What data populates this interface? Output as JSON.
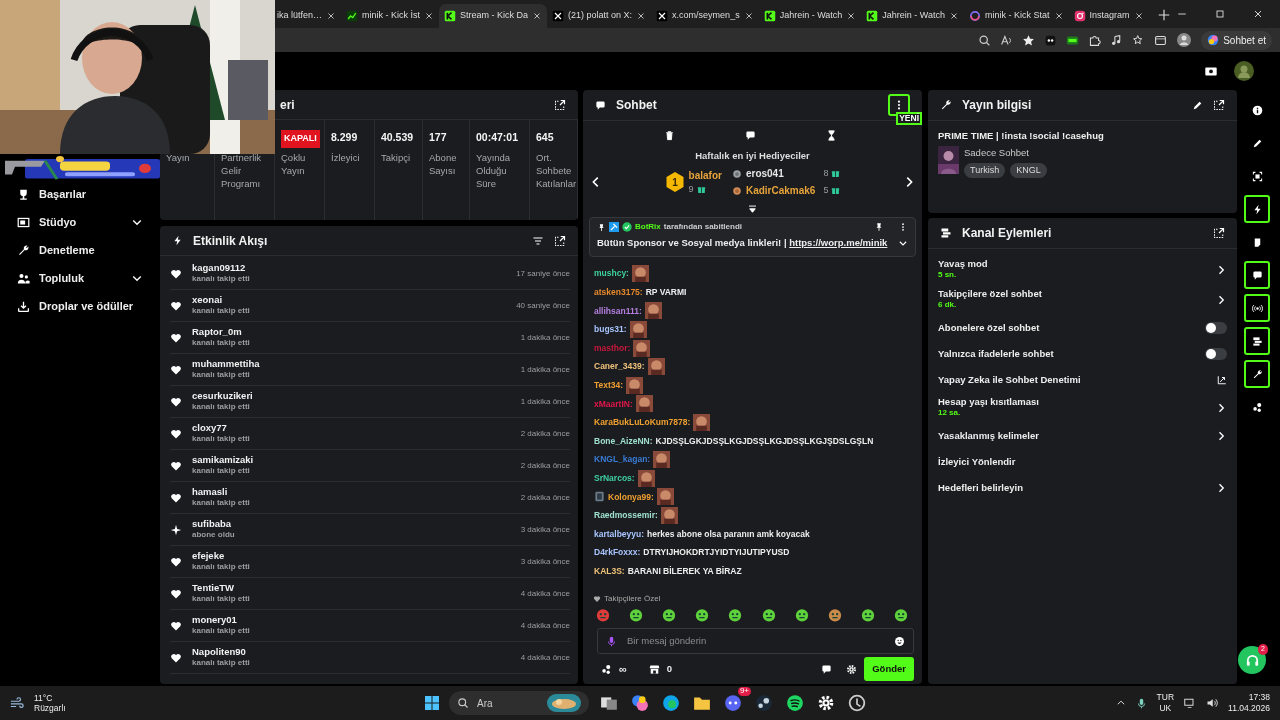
{
  "browser": {
    "tabs": [
      {
        "title": "ika lütfen…",
        "kind": "generic",
        "selected": false
      },
      {
        "title": "minik - Kick İst",
        "kind": "stats",
        "selected": false
      },
      {
        "title": "Stream - Kick Da",
        "kind": "kick",
        "selected": true
      },
      {
        "title": "(21) polatt on X:",
        "kind": "x",
        "selected": false
      },
      {
        "title": "x.com/seymen_s",
        "kind": "x",
        "selected": false
      },
      {
        "title": "Jahrein - Watch",
        "kind": "kick",
        "selected": false
      },
      {
        "title": "Jahrein - Watch",
        "kind": "kick",
        "selected": false
      },
      {
        "title": "minik - Kick Stat",
        "kind": "swirl",
        "selected": false
      },
      {
        "title": "Instagram",
        "kind": "instagram",
        "selected": false
      }
    ],
    "copilot_button": "Sohbet et"
  },
  "sidebar": {
    "items": [
      {
        "label": "Başarılar",
        "expandable": false
      },
      {
        "label": "Stüdyo",
        "expandable": true
      },
      {
        "label": "Denetleme",
        "expandable": false
      },
      {
        "label": "Topluluk",
        "expandable": true
      },
      {
        "label": "Droplar ve ödüller",
        "expandable": false
      }
    ]
  },
  "stats": {
    "title": "eri",
    "items": [
      {
        "label": "Yayın"
      },
      {
        "label": "Partnerlik Gelir Programı"
      },
      {
        "badge": "KAPALI",
        "label": "Çoklu Yayın"
      },
      {
        "value": "8.299",
        "label": "İzleyici"
      },
      {
        "value": "40.539",
        "label": "Takipçi"
      },
      {
        "value": "177",
        "label": "Abone Sayısı"
      },
      {
        "value": "00:47:01",
        "label": "Yayında Olduğu Süre"
      },
      {
        "value": "645",
        "label": "Ort. Sohbete Katılanlar"
      }
    ]
  },
  "activity": {
    "title": "Etkinlik Akışı",
    "events": [
      {
        "kind": "follow",
        "user": "kagan09112",
        "action": "kanalı takip etti",
        "time": "17 saniye önce"
      },
      {
        "kind": "follow",
        "user": "xeonai",
        "action": "kanalı takip etti",
        "time": "40 saniye önce"
      },
      {
        "kind": "follow",
        "user": "Raptor_0m",
        "action": "kanalı takip etti",
        "time": "1 dakika önce"
      },
      {
        "kind": "follow",
        "user": "muhammettiha",
        "action": "kanalı takip etti",
        "time": "1 dakika önce"
      },
      {
        "kind": "follow",
        "user": "cesurkuzikeri",
        "action": "kanalı takip etti",
        "time": "1 dakika önce"
      },
      {
        "kind": "follow",
        "user": "cloxy77",
        "action": "kanalı takip etti",
        "time": "2 dakika önce"
      },
      {
        "kind": "follow",
        "user": "samikamizaki",
        "action": "kanalı takip etti",
        "time": "2 dakika önce"
      },
      {
        "kind": "follow",
        "user": "hamasli",
        "action": "kanalı takip etti",
        "time": "2 dakika önce"
      },
      {
        "kind": "subscribe",
        "user": "sufibaba",
        "action": "abone oldu",
        "time": "3 dakika önce"
      },
      {
        "kind": "follow",
        "user": "efejeke",
        "action": "kanalı takip etti",
        "time": "3 dakika önce"
      },
      {
        "kind": "follow",
        "user": "TentieTW",
        "action": "kanalı takip etti",
        "time": "4 dakika önce"
      },
      {
        "kind": "follow",
        "user": "monery01",
        "action": "kanalı takip etti",
        "time": "4 dakika önce"
      },
      {
        "kind": "follow",
        "user": "Napoliten90",
        "action": "kanalı takip etti",
        "time": "4 dakika önce"
      }
    ]
  },
  "chat": {
    "title": "Sohbet",
    "new_label": "YENİ",
    "gifters": {
      "title": "Haftalık en iyi Hediyeciler",
      "items": [
        {
          "rank": "1",
          "name": "balafor",
          "count": "9",
          "color": "#e8a33a"
        },
        {
          "name": "eros041",
          "count": "8",
          "color": "#e6e6e6"
        },
        {
          "name": "KadirCakmak6",
          "count": "5",
          "color": "#e8a33a"
        }
      ]
    },
    "pinned": {
      "by": "BotRix",
      "by_text": "tarafından sabitlendi",
      "text": "Bütün Sponsor ve Sosyal medya linkleri! |",
      "link": "https://worp.me/minik"
    },
    "messages": [
      {
        "user": "mushcy:",
        "color": "#3ecf9a",
        "kind": "emote",
        "badge": false
      },
      {
        "user": "atsken3175:",
        "color": "#e8892b",
        "kind": "text",
        "text": "RP VARMI",
        "badge": false
      },
      {
        "user": "allihsan111:",
        "color": "#b57fe0",
        "kind": "emote",
        "badge": false
      },
      {
        "user": "bugs31:",
        "color": "#a8c5ff",
        "kind": "emote",
        "badge": false
      },
      {
        "user": "masthor:",
        "color": "#c8163c",
        "kind": "emote",
        "badge": false
      },
      {
        "user": "Caner_3439:",
        "color": "#f0c27a",
        "kind": "emote",
        "badge": false
      },
      {
        "user": "Text34:",
        "color": "#f0a030",
        "kind": "emote",
        "badge": false
      },
      {
        "user": "xMaartIN:",
        "color": "#e0164a",
        "kind": "emote",
        "badge": false
      },
      {
        "user": "KaraBukLuLoKum7878:",
        "color": "#f0a030",
        "kind": "emote",
        "badge": false
      },
      {
        "user": "Bone_AizeNN:",
        "color": "#9fe0d0",
        "kind": "text",
        "text": "KJDSŞLGKJDSŞLKGJDSŞLKGJDSŞLKGJŞDSLGŞLN",
        "badge": false
      },
      {
        "user": "KNGL_kagan:",
        "color": "#3a7bd5",
        "kind": "emote",
        "badge": false
      },
      {
        "user": "SrNarcos:",
        "color": "#3ecfa0",
        "kind": "emote",
        "badge": false
      },
      {
        "user": "Kolonya99:",
        "color": "#f0a030",
        "kind": "emote",
        "badge": true
      },
      {
        "user": "Raedmossemir:",
        "color": "#9fe0d0",
        "kind": "emote",
        "badge": false
      },
      {
        "user": "kartalbeyyu:",
        "color": "#a8c5ff",
        "kind": "text",
        "text": "herkes abone olsa paranın amk koyacak",
        "badge": false
      },
      {
        "user": "D4rkFoxxx:",
        "color": "#a8c5ff",
        "kind": "text",
        "text": "DTRYIJHOKDRTJYIDTYIJUTIPYUSD",
        "badge": false
      },
      {
        "user": "KAL3S:",
        "color": "#f0c27a",
        "kind": "text",
        "text": "BARANI BİLEREK YA BİRAZ",
        "badge": false
      }
    ],
    "mode_label": "Takipçilere Özel",
    "placeholder": "Bir mesaj gönderin",
    "points": "∞",
    "store_count": "0",
    "send": "Gönder"
  },
  "stream_info": {
    "title": "Yayın bilgisi",
    "stream_title": "PRIME TIME | !insta !social !casehug",
    "category": "Sadece Sohbet",
    "tags": [
      "Turkish",
      "KNGL"
    ]
  },
  "channel_actions": {
    "title": "Kanal Eylemleri",
    "items": [
      {
        "kind": "link",
        "label": "Yavaş mod",
        "value": "5 sn."
      },
      {
        "kind": "link",
        "label": "Takipçilere özel sohbet",
        "value": "6 dk."
      },
      {
        "kind": "toggle",
        "label": "Abonelere özel sohbet",
        "on": false
      },
      {
        "kind": "toggle",
        "label": "Yalnızca ifadelerle sohbet",
        "on": false
      },
      {
        "kind": "external",
        "label": "Yapay Zeka ile Sohbet Denetimi"
      },
      {
        "kind": "link",
        "label": "Hesap yaşı kısıtlaması",
        "value": "12 sa."
      },
      {
        "kind": "link",
        "label": "Yasaklanmış kelimeler"
      },
      {
        "kind": "plain",
        "label": "İzleyici Yönlendir"
      },
      {
        "kind": "link",
        "label": "Hedefleri belirleyin"
      }
    ]
  },
  "rail": [
    {
      "kind": "info",
      "on": false
    },
    {
      "kind": "pencil",
      "on": false
    },
    {
      "kind": "focus",
      "on": false
    },
    {
      "kind": "bolt",
      "on": true
    },
    {
      "kind": "note",
      "on": false
    },
    {
      "kind": "chat",
      "on": true
    },
    {
      "kind": "broadcast",
      "on": true
    },
    {
      "kind": "actions",
      "on": true
    },
    {
      "kind": "wrench",
      "on": true
    },
    {
      "kind": "drops",
      "on": false
    }
  ],
  "help_badge": "2",
  "taskbar": {
    "temperature": "11°C",
    "weather": "Rüzgarlı",
    "search": "Ara",
    "discord_badge": "9+",
    "language": "TUR",
    "layout": "UK",
    "time": "17:38",
    "date": "11.04.2026"
  }
}
